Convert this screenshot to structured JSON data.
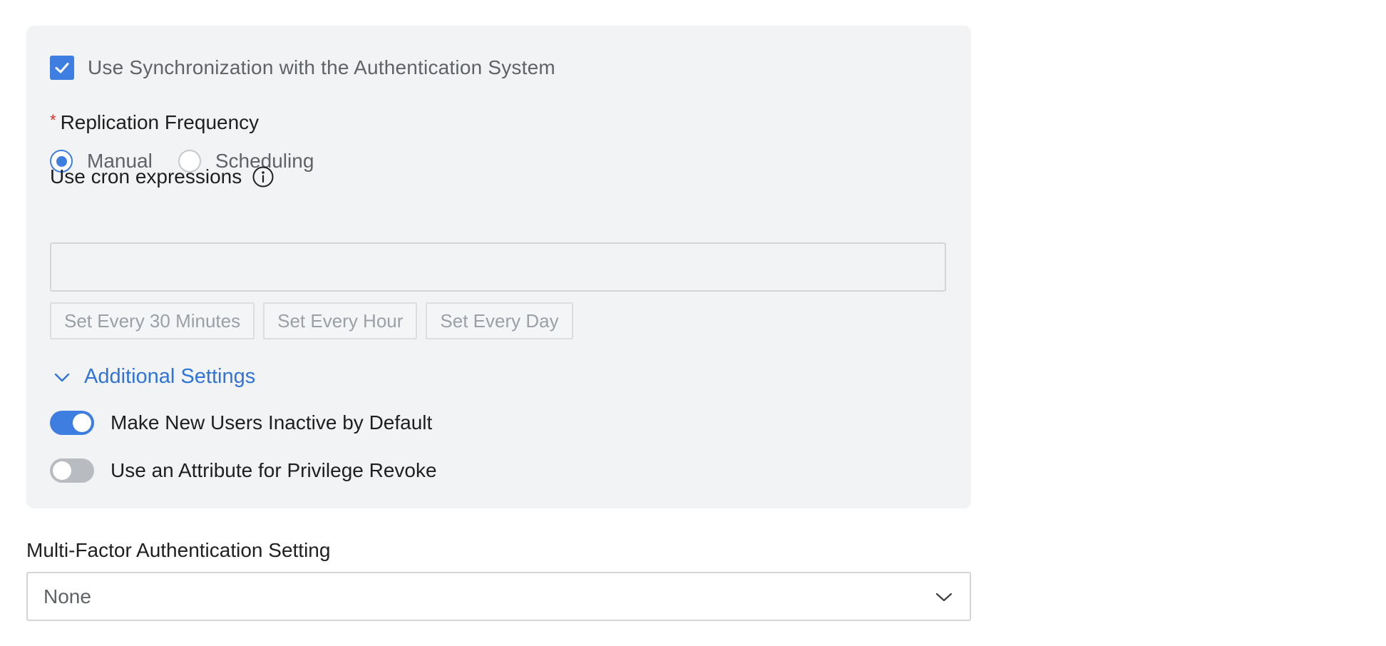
{
  "sync": {
    "checked": true,
    "label": "Use Synchronization with the Authentication System"
  },
  "replication": {
    "required_mark": "*",
    "label": "Replication Frequency",
    "options": [
      {
        "label": "Manual",
        "selected": true
      },
      {
        "label": "Scheduling",
        "selected": false
      }
    ]
  },
  "cron": {
    "label": "Use cron expressions",
    "value": "",
    "presets": [
      "Set Every 30 Minutes",
      "Set Every Hour",
      "Set Every Day"
    ]
  },
  "additional": {
    "label": "Additional Settings",
    "expanded": true,
    "toggles": [
      {
        "label": "Make New Users Inactive by Default",
        "on": true
      },
      {
        "label": "Use an Attribute for Privilege Revoke",
        "on": false
      }
    ]
  },
  "mfa": {
    "label": "Multi-Factor Authentication Setting",
    "selected": "None"
  },
  "colors": {
    "accent": "#3d7ee0",
    "link": "#2f74d6",
    "required": "#d93025",
    "panel_bg": "#f2f3f5"
  }
}
